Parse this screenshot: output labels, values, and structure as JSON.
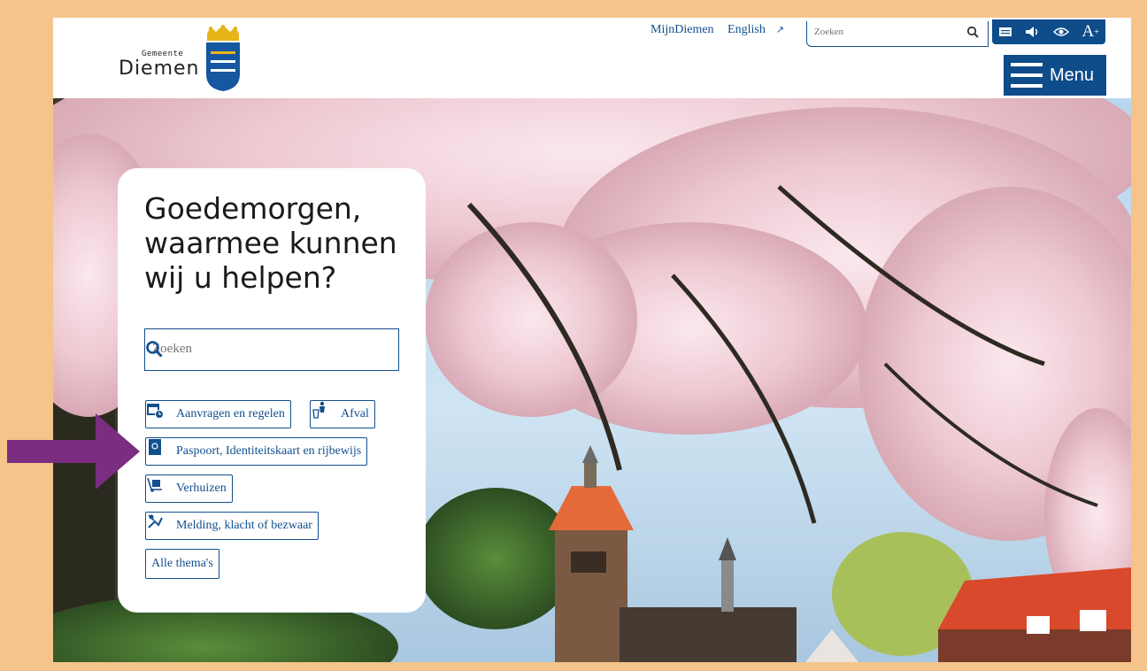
{
  "header": {
    "logo_small": "Gemeente",
    "logo_big": "Diemen",
    "links": [
      {
        "label": "MijnDiemen"
      },
      {
        "label": "English"
      }
    ],
    "search_placeholder": "Zoeken",
    "menu_label": "Menu",
    "tools": [
      "read-aloud-icon",
      "speaker-icon",
      "eye-icon",
      "font-size-icon"
    ],
    "font_size_label": "A",
    "font_size_plus": "+"
  },
  "hero": {
    "greeting_lines": [
      "Goedemorgen,",
      "waarmee kunnen",
      "wij u helpen?"
    ],
    "search_placeholder": "Zoeken",
    "topics": [
      {
        "label": "Aanvragen en regelen",
        "icon": "calendar-clock-icon"
      },
      {
        "label": "Afval",
        "icon": "waste-bin-icon"
      },
      {
        "label": "Paspoort, Identiteitskaart en rijbewijs",
        "icon": "passport-icon"
      },
      {
        "label": "Verhuizen",
        "icon": "moving-cart-icon"
      },
      {
        "label": "Melding, klacht of bezwaar",
        "icon": "report-icon"
      },
      {
        "label": "Alle thema's",
        "icon": ""
      }
    ]
  },
  "colors": {
    "brand_blue": "#0e4c8a",
    "frame": "#f4c48b",
    "annotation_arrow": "#7b2d82"
  }
}
